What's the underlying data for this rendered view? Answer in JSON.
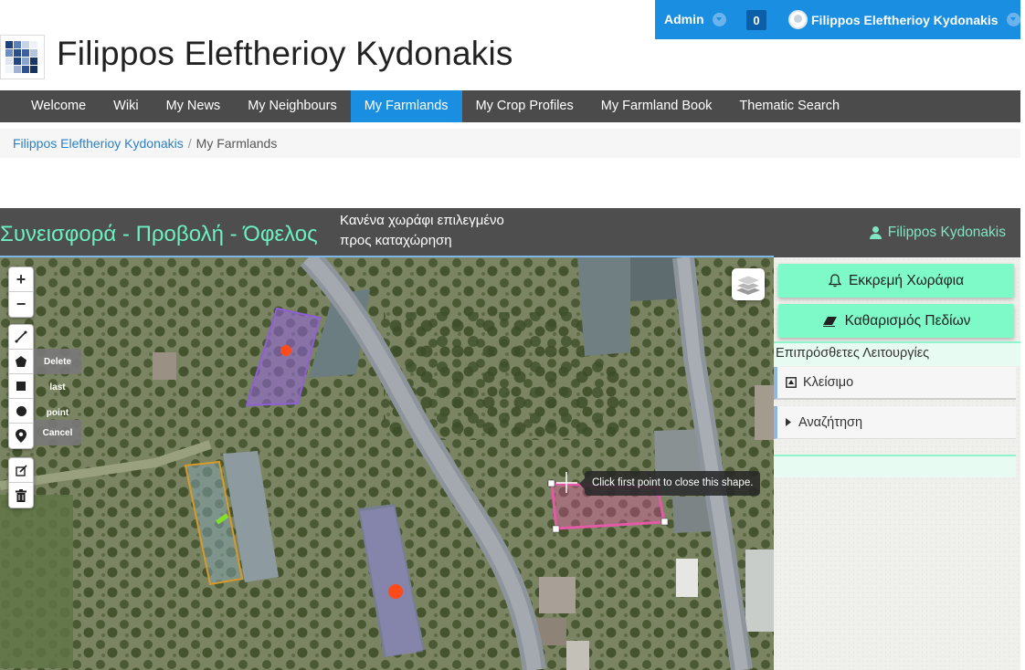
{
  "admin_bar": {
    "admin_label": "Admin",
    "notification_count": "0",
    "user_name": "Filippos Eleftherioy Kydonakis"
  },
  "site": {
    "title": "Filippos Eleftherioy Kydonakis"
  },
  "nav": {
    "items": [
      {
        "label": "Welcome"
      },
      {
        "label": "Wiki"
      },
      {
        "label": "My News"
      },
      {
        "label": "My Neighbours"
      },
      {
        "label": "My Farmlands",
        "active": true
      },
      {
        "label": "My Crop Profiles"
      },
      {
        "label": "My Farmland Book"
      },
      {
        "label": "Thematic Search"
      }
    ]
  },
  "breadcrumb": {
    "home": "Filippos Eleftherioy Kydonakis",
    "separator": "/",
    "current": "My Farmlands"
  },
  "app": {
    "title": "Συνεισφορά - Προβολή - Όφελος",
    "status_line1": "Κανένα χωράφι επιλεγμένο",
    "status_line2": "προς καταχώρηση",
    "user": "Filippos Kydonakis"
  },
  "map": {
    "zoom_in": "+",
    "zoom_out": "−",
    "draw_actions": {
      "delete": "Delete",
      "last": "last",
      "point": "point",
      "cancel": "Cancel"
    },
    "tooltip": "Click first point to close this shape."
  },
  "side_panel": {
    "pending_button": "Εκκρεμή Χωράφια",
    "clear_button": "Καθαρισμός Πεδίων",
    "extra_title": "Επιπρόσθετες Λειτουργίες",
    "close_label": "Κλείσιμο",
    "search_label": "Αναζήτηση"
  },
  "colors": {
    "accent_blue": "#1a8ee0",
    "nav_dark": "#4b4b4b",
    "mint_green": "#7dfac8",
    "header_title_green": "#6cf0c2"
  }
}
